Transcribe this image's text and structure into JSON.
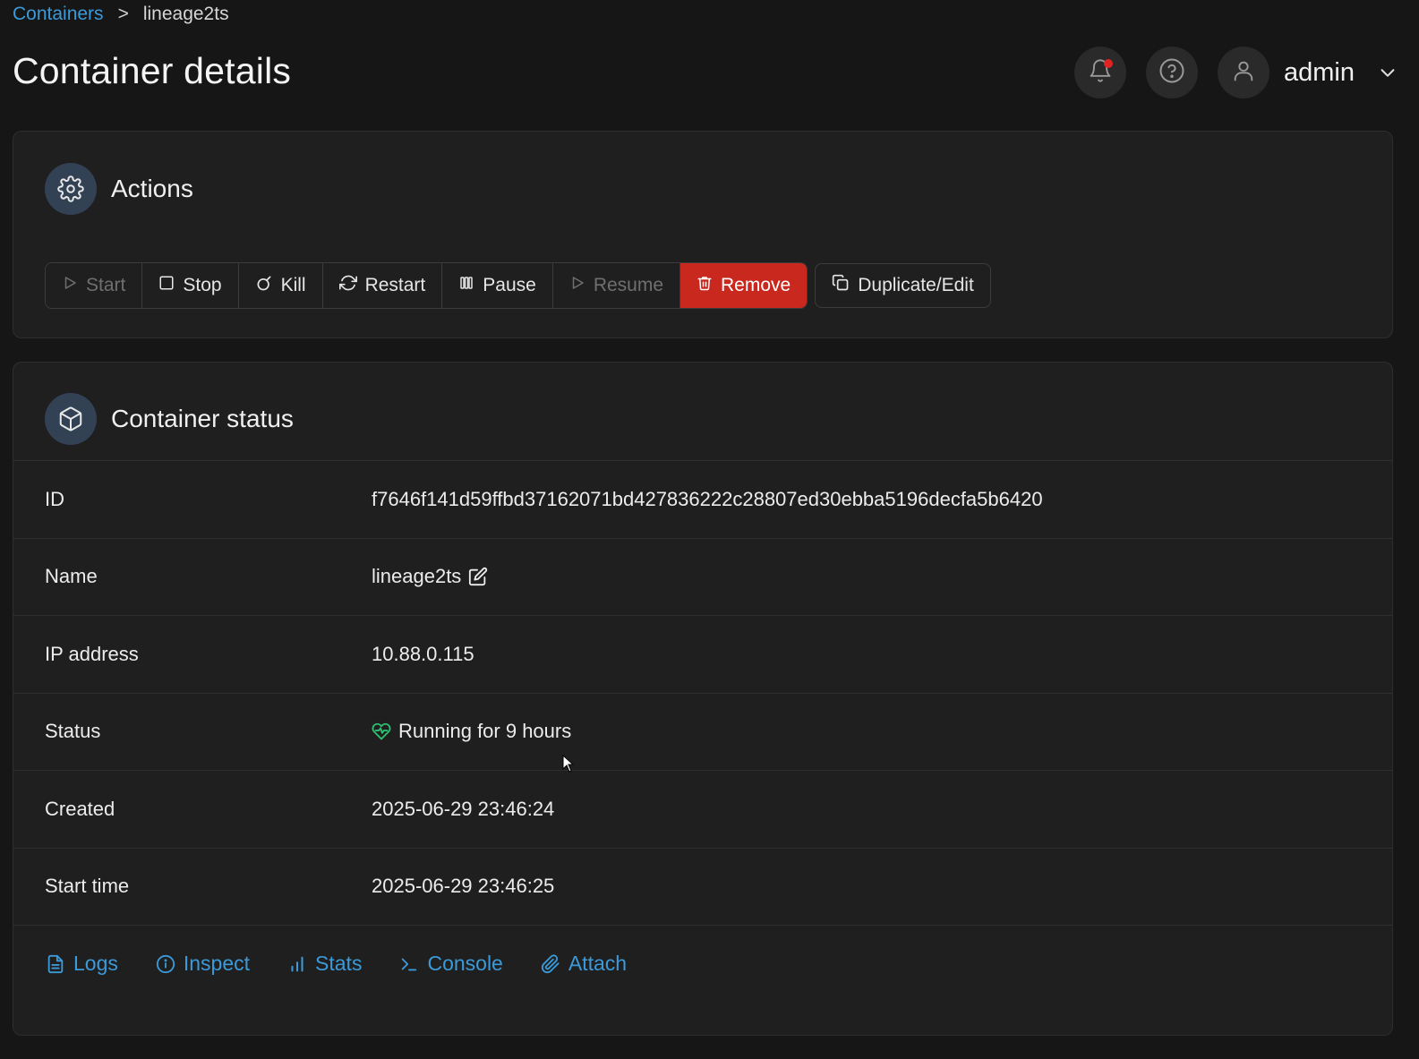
{
  "breadcrumb": {
    "parent": "Containers",
    "separator": ">",
    "current": "lineage2ts"
  },
  "page": {
    "title": "Container details"
  },
  "header": {
    "user": "admin",
    "icons": [
      "bell-icon",
      "help-icon",
      "user-icon",
      "chevron-down-icon"
    ]
  },
  "actions": {
    "title": "Actions",
    "buttons": {
      "start": "Start",
      "stop": "Stop",
      "kill": "Kill",
      "restart": "Restart",
      "pause": "Pause",
      "resume": "Resume",
      "remove": "Remove",
      "duplicate": "Duplicate/Edit"
    }
  },
  "status": {
    "title": "Container status",
    "rows": [
      {
        "label": "ID",
        "value": "f7646f141d59ffbd37162071bd427836222c28807ed30ebba5196decfa5b6420"
      },
      {
        "label": "Name",
        "value": "lineage2ts"
      },
      {
        "label": "IP address",
        "value": "10.88.0.115"
      },
      {
        "label": "Status",
        "value": "Running for 9 hours"
      },
      {
        "label": "Created",
        "value": "2025-06-29 23:46:24"
      },
      {
        "label": "Start time",
        "value": "2025-06-29 23:46:25"
      }
    ],
    "links": [
      "Logs",
      "Inspect",
      "Stats",
      "Console",
      "Attach"
    ]
  },
  "colors": {
    "accent": "#3b9ad9",
    "danger": "#c9281e",
    "healthy": "#2fbf71",
    "background": "#161616",
    "card": "#1f1f1f"
  }
}
